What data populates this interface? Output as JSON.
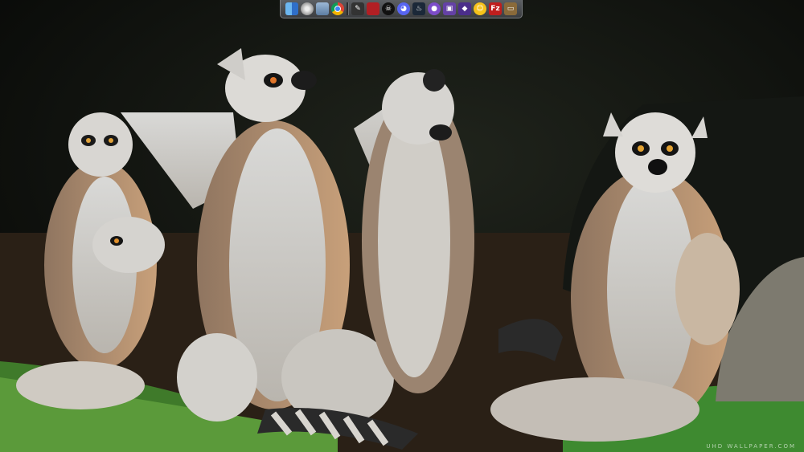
{
  "desktop": {
    "wallpaper_name": "ring-tailed-lemurs-sunbathing",
    "watermark_text": "UHD WALLPAPER.COM"
  },
  "dock": {
    "items": [
      {
        "name": "finder-icon",
        "glyph": "",
        "bg": "#3c78c8"
      },
      {
        "name": "system-disk-icon",
        "glyph": "",
        "bg": "#b8bcc2"
      },
      {
        "name": "folder-icon",
        "glyph": "",
        "bg": "#6e8fb0"
      },
      {
        "name": "chrome-icon",
        "glyph": "",
        "bg": "#e8e8e8"
      },
      {
        "name": "separator",
        "glyph": "",
        "bg": ""
      },
      {
        "name": "pen-tool-icon",
        "glyph": "✎",
        "bg": "#333333"
      },
      {
        "name": "red-book-icon",
        "glyph": "",
        "bg": "#b21f24"
      },
      {
        "name": "skull-icon",
        "glyph": "☠",
        "bg": "#111111"
      },
      {
        "name": "discord-icon",
        "glyph": "◕",
        "bg": "#5865f2"
      },
      {
        "name": "steam-icon",
        "glyph": "♨",
        "bg": "#1b2838"
      },
      {
        "name": "obs-icon",
        "glyph": "●",
        "bg": "#7d4cc9"
      },
      {
        "name": "twitch-icon",
        "glyph": "▣",
        "bg": "#6441a5"
      },
      {
        "name": "vpn-shield-icon",
        "glyph": "◆",
        "bg": "#4b2d8a"
      },
      {
        "name": "emoji-face-icon",
        "glyph": "☺",
        "bg": "#f6c21a"
      },
      {
        "name": "filezilla-icon",
        "glyph": "Fz",
        "bg": "#bf1e1e"
      },
      {
        "name": "terminal-icon",
        "glyph": "▭",
        "bg": "#8a6a3a"
      }
    ]
  }
}
